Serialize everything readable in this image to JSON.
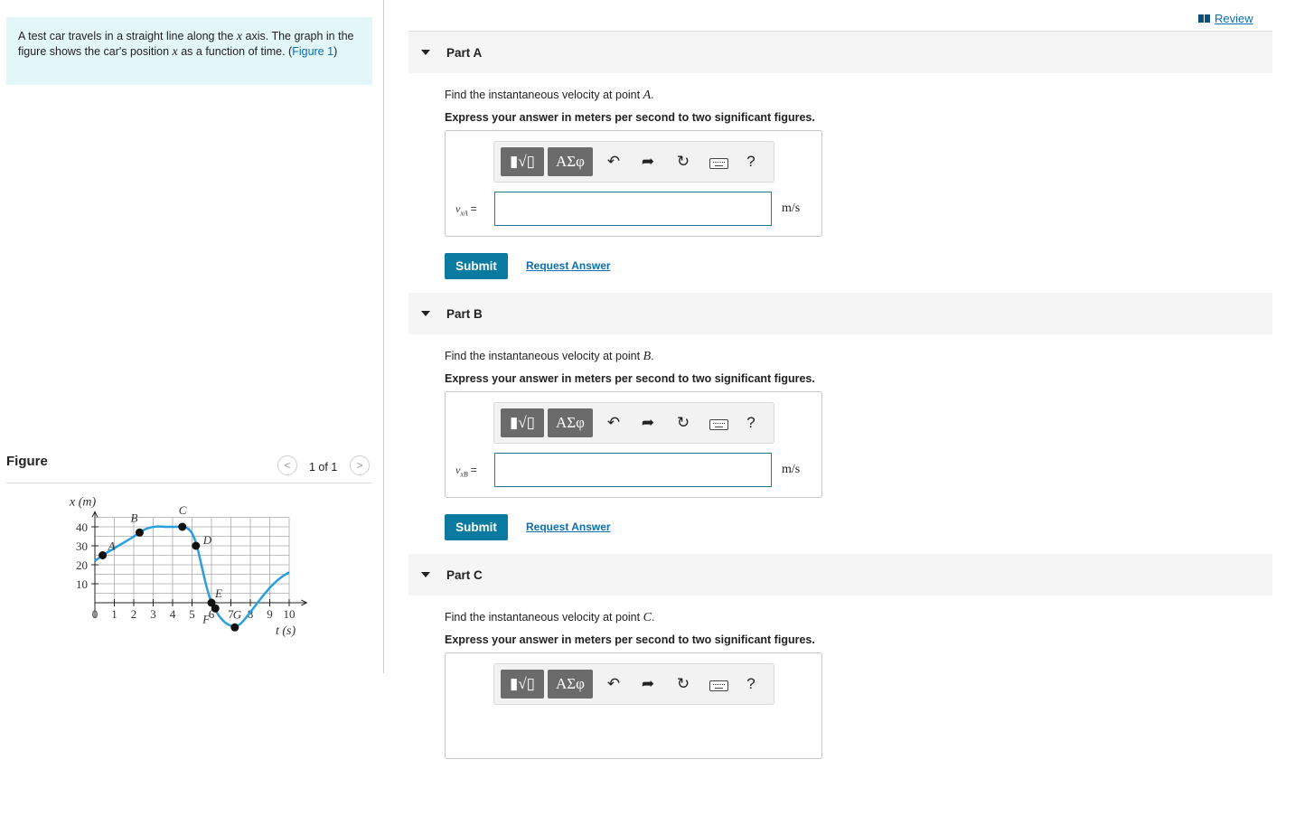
{
  "intro": {
    "text_before": "A test car travels in a straight line along the ",
    "var_x": "x",
    "text_mid": " axis. The graph in the figure shows the car's position ",
    "var_x2": "x",
    "text_after": " as a function of time. (",
    "figure_link": "Figure 1",
    "close_paren": ")"
  },
  "figure_panel": {
    "title": "Figure",
    "counter": "1 of 1",
    "prev_icon": "chevron-left-icon",
    "next_icon": "chevron-right-icon"
  },
  "graph": {
    "x_axis_label": "t (s)",
    "y_axis_label": "x (m)",
    "x_ticks": [
      "0",
      "1",
      "2",
      "3",
      "4",
      "5",
      "6",
      "7",
      "8",
      "9",
      "10"
    ],
    "y_ticks": [
      "40",
      "30",
      "20",
      "10"
    ],
    "points": [
      {
        "label": "A",
        "t": 0.4,
        "x": 25
      },
      {
        "label": "B",
        "t": 2.3,
        "x": 37
      },
      {
        "label": "C",
        "t": 4.5,
        "x": 40
      },
      {
        "label": "D",
        "t": 5.2,
        "x": 30
      },
      {
        "label": "E",
        "t": 6.0,
        "x": 0
      },
      {
        "label": "F",
        "t": 6.2,
        "x": -3
      },
      {
        "label": "G",
        "t": 7.2,
        "x": -13
      }
    ]
  },
  "header": {
    "review_label": "Review"
  },
  "toolbar": {
    "template_label": "▮√▯",
    "symbols_label": "ΑΣφ",
    "undo_icon": "undo-icon",
    "redo_icon": "redo-icon",
    "reset_icon": "reset-icon",
    "keyboard_icon": "keyboard-icon",
    "help_label": "?"
  },
  "parts": [
    {
      "title": "Part A",
      "question_prefix": "Find the instantaneous velocity at point ",
      "point": "A",
      "question_suffix": ".",
      "instruction": "Express your answer in meters per second to two significant figures.",
      "variable": "v",
      "variable_sub": "xA",
      "equals": "=",
      "value": "",
      "unit": "m/s",
      "submit_label": "Submit",
      "request_label": "Request Answer"
    },
    {
      "title": "Part B",
      "question_prefix": "Find the instantaneous velocity at point ",
      "point": "B",
      "question_suffix": ".",
      "instruction": "Express your answer in meters per second to two significant figures.",
      "variable": "v",
      "variable_sub": "xB",
      "equals": "=",
      "value": "",
      "unit": "m/s",
      "submit_label": "Submit",
      "request_label": "Request Answer"
    },
    {
      "title": "Part C",
      "question_prefix": "Find the instantaneous velocity at point ",
      "point": "C",
      "question_suffix": ".",
      "instruction": "Express your answer in meters per second to two significant figures."
    }
  ]
}
